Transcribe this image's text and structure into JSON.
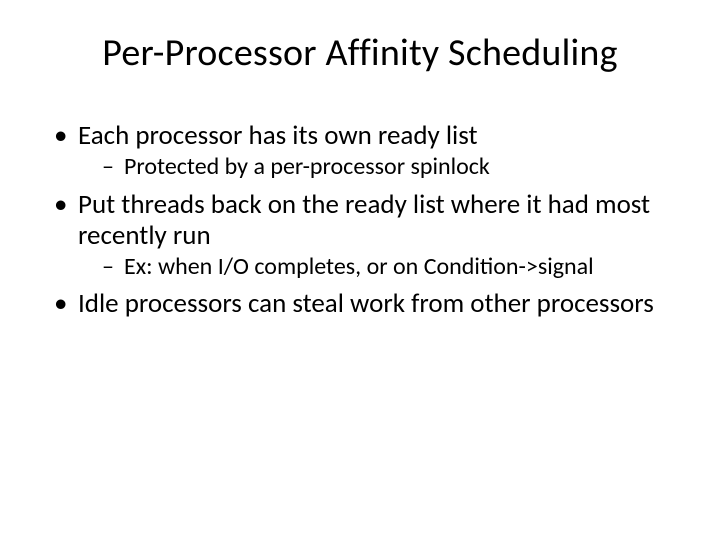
{
  "title": "Per-Processor Affinity Scheduling",
  "bullets": [
    {
      "text": "Each processor has its own ready list",
      "sub": [
        "Protected by a per-processor spinlock"
      ]
    },
    {
      "text": "Put threads back on the ready list where it had most recently run",
      "sub": [
        "Ex: when I/O completes, or on Condition->signal"
      ]
    },
    {
      "text": "Idle processors can steal work from other processors",
      "sub": []
    }
  ]
}
